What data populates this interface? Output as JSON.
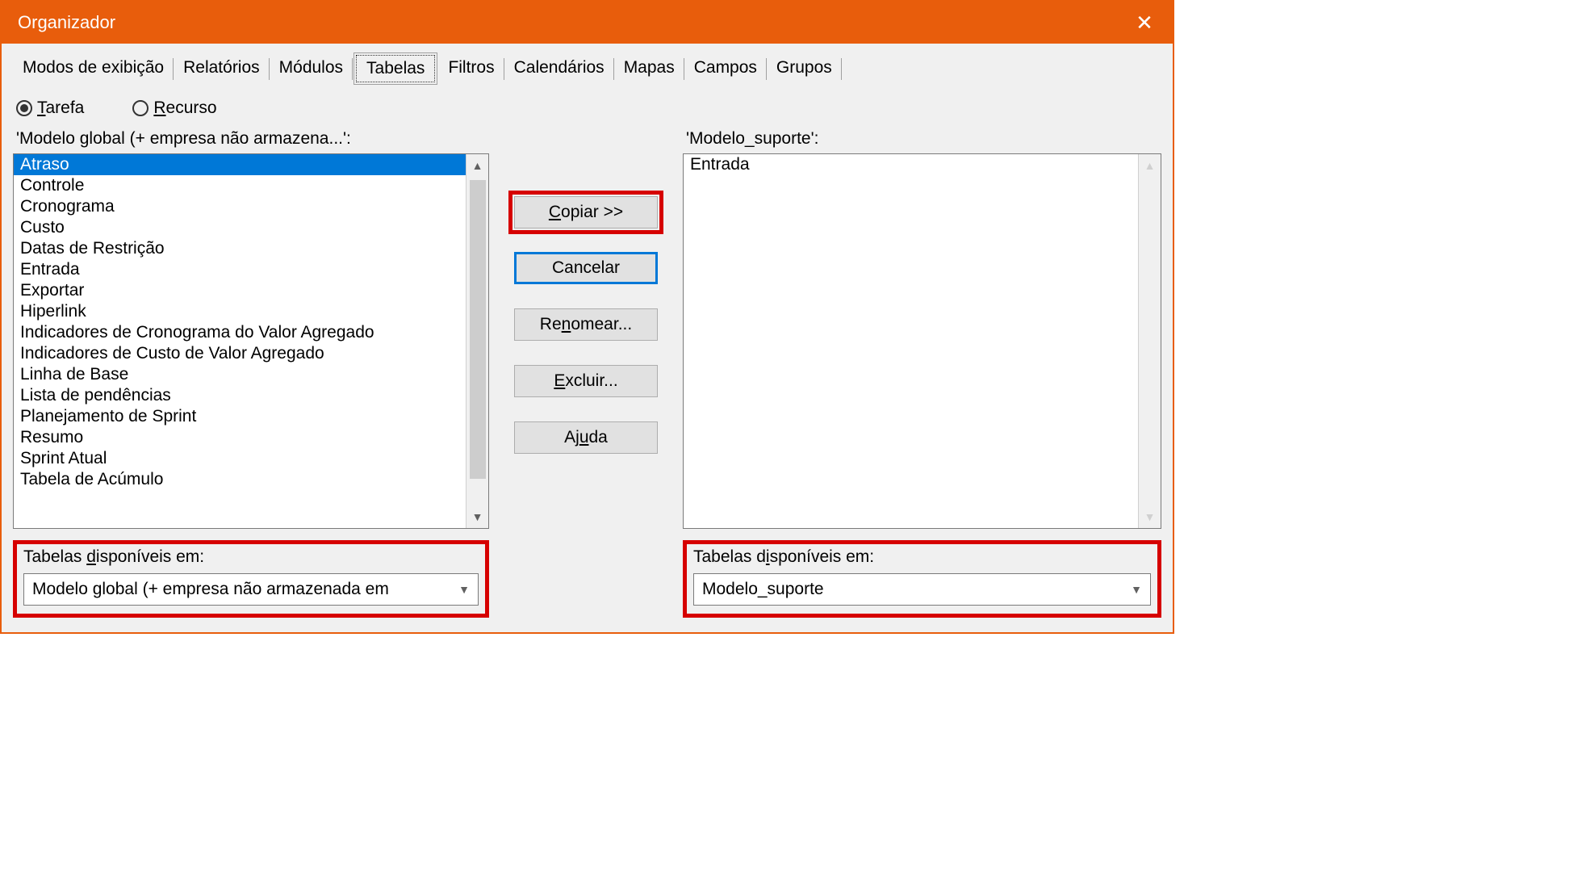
{
  "title": "Organizador",
  "tabs": [
    "Modos de exibição",
    "Relatórios",
    "Módulos",
    "Tabelas",
    "Filtros",
    "Calendários",
    "Mapas",
    "Campos",
    "Grupos"
  ],
  "active_tab_index": 3,
  "radios": {
    "tarefa": "Tarefa",
    "recurso": "Recurso"
  },
  "left": {
    "label": "'Modelo global (+ empresa não armazena...':",
    "items": [
      "Atraso",
      "Controle",
      "Cronograma",
      "Custo",
      "Datas de Restrição",
      "Entrada",
      "Exportar",
      "Hiperlink",
      "Indicadores de Cronograma do Valor Agregado",
      "Indicadores de Custo de Valor Agregado",
      "Linha de Base",
      "Lista de pendências",
      "Planejamento de Sprint",
      "Resumo",
      "Sprint Atual",
      "Tabela de Acúmulo"
    ],
    "selected_index": 0,
    "footer_label": "Tabelas disponíveis em:",
    "combo_value": "Modelo global (+ empresa não armazenada em"
  },
  "right": {
    "label": "'Modelo_suporte':",
    "items": [
      "Entrada"
    ],
    "footer_label": "Tabelas disponíveis em:",
    "combo_value": "Modelo_suporte"
  },
  "buttons": {
    "copy": "Copiar >>",
    "cancel": "Cancelar",
    "rename": "Renomear...",
    "delete": "Excluir...",
    "help": "Ajuda"
  }
}
